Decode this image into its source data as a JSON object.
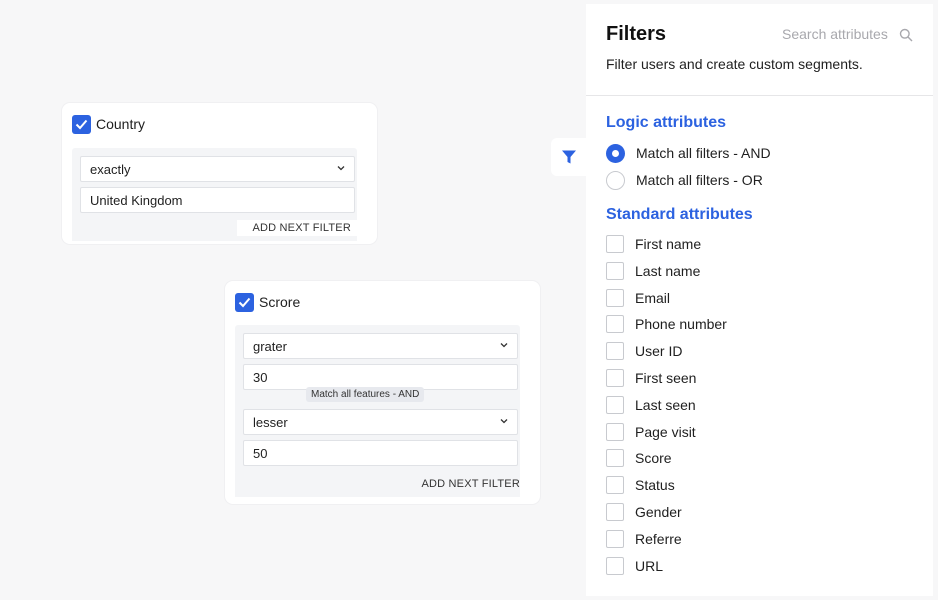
{
  "country_card": {
    "title": "Country",
    "checked": true,
    "operator": "exactly",
    "value": "United Kingdom",
    "add_next": "ADD NEXT FILTER"
  },
  "score_card": {
    "title": "Scrore",
    "checked": true,
    "operator_1": "grater",
    "value_1": "30",
    "connector": "Match all features - AND",
    "operator_2": "lesser",
    "value_2": "50",
    "add_next": "ADD NEXT FILTER"
  },
  "panel": {
    "title": "Filters",
    "search_placeholder": "Search attributes",
    "subtitle": "Filter users and create custom segments.",
    "logic_title": "Logic attributes",
    "logic_options": [
      {
        "label": "Match all filters - AND",
        "selected": true
      },
      {
        "label": "Match all filters - OR",
        "selected": false
      }
    ],
    "standard_title": "Standard attributes",
    "standard_items": [
      "First name",
      "Last name",
      "Email",
      "Phone number",
      "User ID",
      "First seen",
      "Last seen",
      "Page visit",
      "Score",
      "Status",
      "Gender",
      "Referre",
      "URL"
    ]
  },
  "icons": {
    "filter_toggle": "filter-icon",
    "search": "search-icon",
    "dropdown": "chevron-down-icon",
    "checked": "check-icon"
  },
  "colors": {
    "accent": "#2c62e0",
    "background": "#f7f7f8",
    "filter_area": "#f4f5f7"
  }
}
